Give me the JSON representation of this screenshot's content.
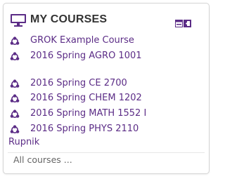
{
  "block": {
    "title": "MY COURSES",
    "icon": "monitor-icon",
    "controls": {
      "dock_icon": "dock-icon",
      "hide_icon": "hide-icon"
    }
  },
  "courses": [
    {
      "label": "GROK Example Course",
      "icon": "course-icon"
    },
    {
      "label": "2016 Spring AGRO 1001",
      "icon": "course-icon"
    },
    {
      "label": "2016 Spring CE 2700",
      "icon": "course-icon"
    },
    {
      "label": "2016 Spring CHEM 1202",
      "icon": "course-icon"
    },
    {
      "label": "2016 Spring MATH 1552 I",
      "icon": "course-icon"
    },
    {
      "label": "2016 Spring PHYS 2110",
      "icon": "course-icon"
    }
  ],
  "overflow_text": "Rupnik",
  "footer": {
    "all_courses_label": "All courses ..."
  },
  "colors": {
    "accent": "#5b2c86",
    "title": "#333333",
    "muted": "#666666",
    "border": "#d4d4d4"
  }
}
